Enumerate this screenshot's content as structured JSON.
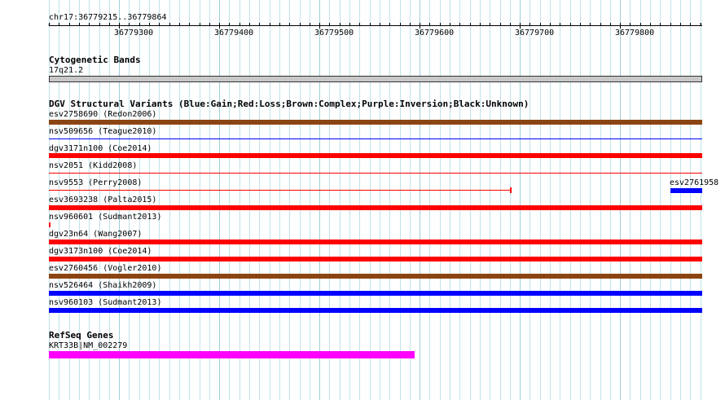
{
  "ruler": {
    "range_label": "chr17:36779215..36779864",
    "tick_labels": [
      "36779300",
      "36779400",
      "36779500",
      "36779600",
      "36779700",
      "36779800"
    ]
  },
  "cytoband": {
    "title": "Cytogenetic Bands",
    "band": "17q21.2"
  },
  "dgv": {
    "title": "DGV Structural Variants (Blue:Gain;Red:Loss;Brown:Complex;Purple:Inversion;Black:Unknown)",
    "variants": [
      {
        "label": "esv2758690 (Redon2006)",
        "type": "Complex",
        "color": "#8b4513"
      },
      {
        "label": "nsv509656 (Teague2010)",
        "type": "Gain",
        "color": "#0000ff"
      },
      {
        "label": "dgv3171n100 (Coe2014)",
        "type": "Loss",
        "color": "#ff0000"
      },
      {
        "label": "nsv2051 (Kidd2008)",
        "type": "Loss",
        "color": "#ff0000"
      },
      {
        "label": "nsv9553 (Perry2008)",
        "type": "Loss",
        "color": "#ff0000"
      },
      {
        "label": "esv2761958",
        "type": "Gain",
        "color": "#0000ff"
      },
      {
        "label": "esv3693238 (Palta2015)",
        "type": "Loss",
        "color": "#ff0000"
      },
      {
        "label": "nsv960601 (Sudmant2013)",
        "type": "Loss",
        "color": "#ff0000"
      },
      {
        "label": "dgv23n64 (Wang2007)",
        "type": "Loss",
        "color": "#ff0000"
      },
      {
        "label": "dgv3173n100 (Coe2014)",
        "type": "Loss",
        "color": "#ff0000"
      },
      {
        "label": "esv2760456 (Vogler2010)",
        "type": "Complex",
        "color": "#8b4513"
      },
      {
        "label": "nsv526464 (Shaikh2009)",
        "type": "Gain",
        "color": "#0000ff"
      },
      {
        "label": "nsv960103 (Sudmant2013)",
        "type": "Gain",
        "color": "#0000ff"
      }
    ]
  },
  "refseq": {
    "title": "RefSeq Genes",
    "gene": "KRT33B|NM_002279",
    "color": "#ff00ff"
  }
}
